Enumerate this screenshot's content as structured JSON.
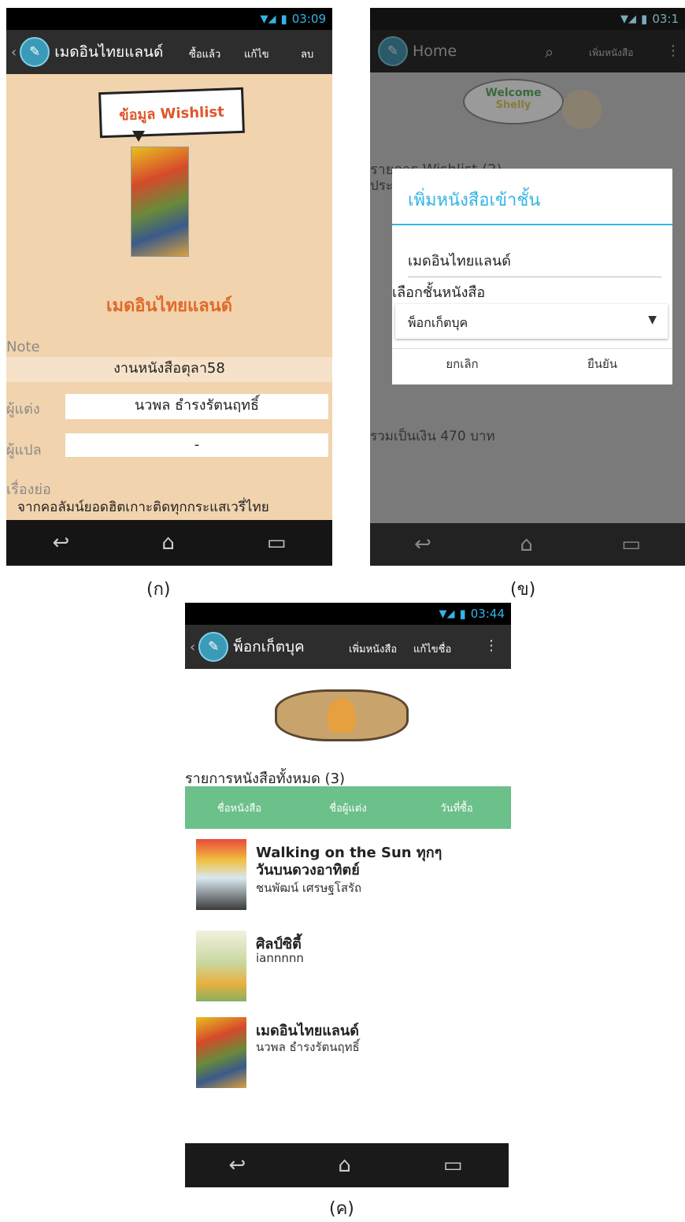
{
  "screen_a": {
    "status_time": "03:09",
    "title": "เมดอินไทยแลนด์",
    "actions": [
      "ซื้อแล้ว",
      "แก้ไข",
      "ลบ"
    ],
    "sign": "ข้อมูล Wishlist",
    "book_name": "เมดอินไทยแลนด์",
    "note_label": "Note",
    "note_value": "งานหนังสือตุลา58",
    "author_label": "ผู้แต่ง",
    "author_value": "นวพล ธำรงรัตนฤทธิ์",
    "translator_label": "ผู้แปล",
    "translator_value": "-",
    "synopsis_label": "เรื่องย่อ",
    "synopsis_text": "จากคอลัมน์ยอดฮิตเกาะติดทุกกระแสเวรี่ไทย",
    "caption": "(ก)"
  },
  "screen_b": {
    "status_time": "03:1",
    "title": "Home",
    "action": "เพิ่มหนังสือ",
    "welcome_text": "Welcome",
    "welcome_name": "Shelly",
    "bg_heading": "รายการ Wishlist (2)",
    "bg_sub": "ประ",
    "bg_total": "รวมเป็นเงิน 470 บาท",
    "dialog": {
      "title": "เพิ่มหนังสือเข้าชั้น",
      "input_value": "เมดอินไทยแลนด์",
      "shelf_label": "เลือกชั้นหนังสือ",
      "shelf_selected": "พ็อกเก็ตบุค",
      "cancel": "ยกเลิก",
      "confirm": "ยืนยัน"
    },
    "caption": "(ข)"
  },
  "screen_c": {
    "status_time": "03:44",
    "title": "พ็อกเก็ตบุค",
    "actions": [
      "เพิ่มหนังสือ",
      "แก้ไขชื่อ"
    ],
    "list_heading": "รายการหนังสือทั้งหมด (3)",
    "columns": [
      "ชื่อหนังสือ",
      "ชื่อผู้แต่ง",
      "วันที่ซื้อ"
    ],
    "books": [
      {
        "title_line1": "Walking on the Sun ทุกๆ",
        "title_line2": "วันบนดวงอาทิตย์",
        "author": "ชนพัฒน์ เศรษฐโสรัถ"
      },
      {
        "title_line1": "ศิลป์ซิตี้",
        "title_line2": "",
        "author": "iannnnn"
      },
      {
        "title_line1": "เมดอินไทยแลนด์",
        "title_line2": "",
        "author": "นวพล ธำรงรัตนฤทธิ์"
      }
    ],
    "caption": "(ค)"
  },
  "colors": {
    "beige": "#f1d3ad",
    "actionbar": "#2d2d2d",
    "accent_blue": "#33b5e5",
    "green_header": "#6cc08a",
    "orange_title": "#e06a2a"
  }
}
